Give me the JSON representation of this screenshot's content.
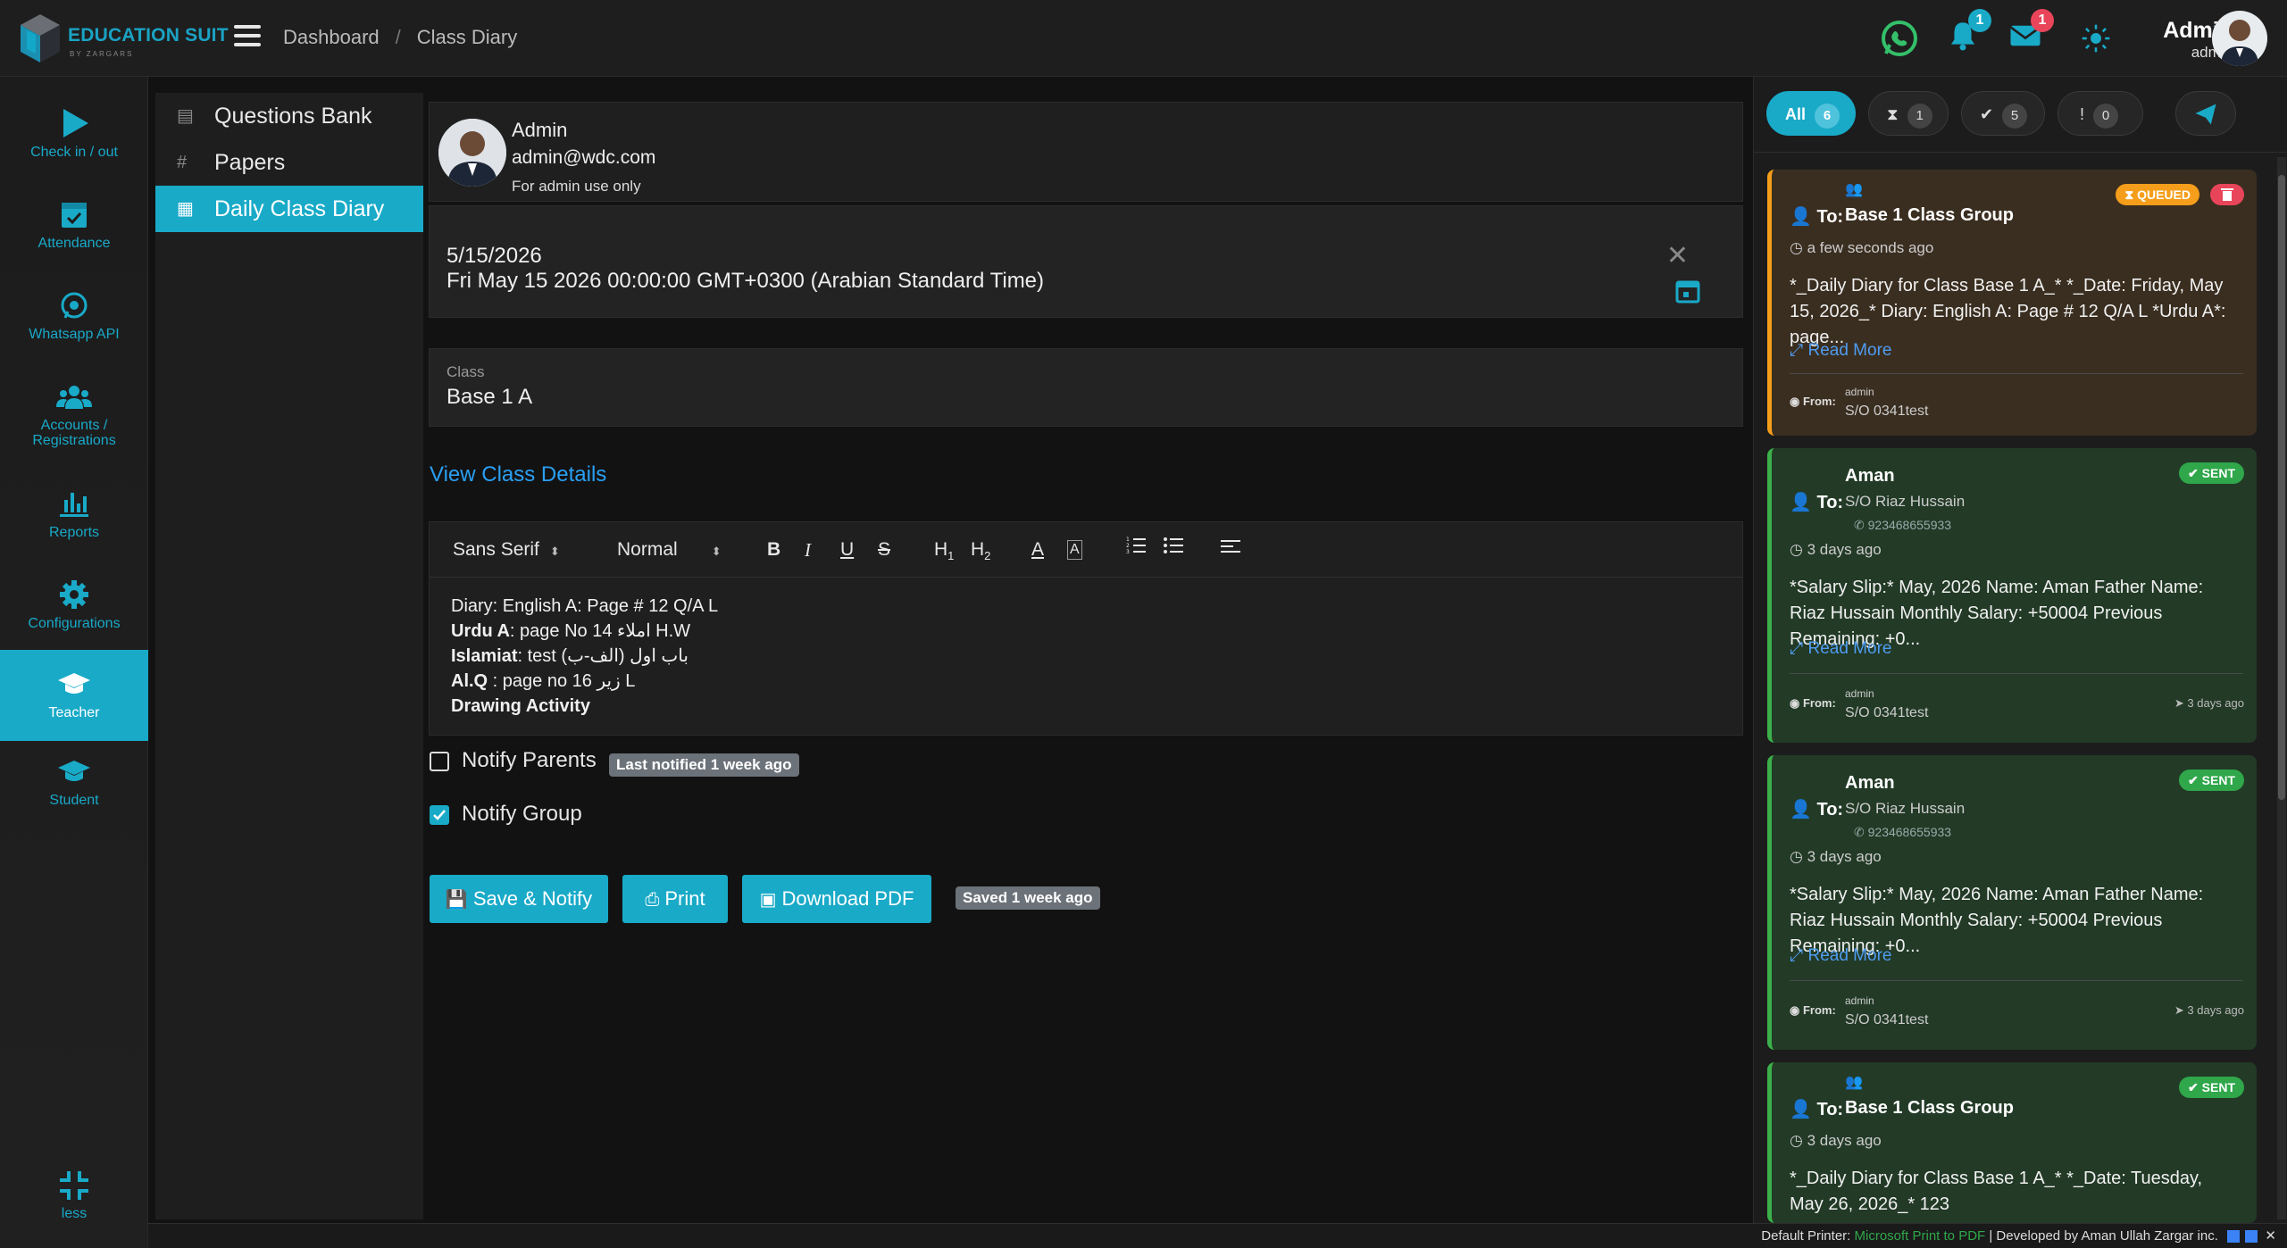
{
  "brand": {
    "title": "EDUCATION SUIT",
    "subtitle": "BY ZARGARS"
  },
  "breadcrumb": {
    "home": "Dashboard",
    "sep": "/",
    "current": "Class Diary"
  },
  "topbar": {
    "notif_count": "1",
    "mail_count": "1",
    "user_name": "Admin",
    "user_role": "admin"
  },
  "leftnav": {
    "checkin": "Check in / out",
    "attendance": "Attendance",
    "whatsapp": "Whatsapp API",
    "accounts_line1": "Accounts /",
    "accounts_line2": "Registrations",
    "reports": "Reports",
    "configurations": "Configurations",
    "teacher": "Teacher",
    "student": "Student",
    "less": "less"
  },
  "submenu": {
    "items": [
      "Questions Bank",
      "Papers",
      "Daily Class Diary"
    ]
  },
  "profile": {
    "name": "Admin",
    "email": "admin@wdc.com",
    "note": "For admin use only"
  },
  "date": {
    "short": "5/15/2026",
    "long": "Fri May 15 2026 00:00:00 GMT+0300 (Arabian Standard Time)",
    "close": "✕"
  },
  "class_field": {
    "label": "Class",
    "value": "Base 1 A"
  },
  "view_class_link": "View Class Details",
  "editor": {
    "font": "Sans Serif",
    "size": "Normal",
    "lines": [
      {
        "bold": "",
        "text": "Diary: English A: Page # 12 Q/A L"
      },
      {
        "bold": "Urdu A",
        "text": ": page No 14 املاء H.W"
      },
      {
        "bold": "Islamiat",
        "text": ": test (الف-ب) باب اول"
      },
      {
        "bold": "Al.Q",
        "text": " : page no 16 زیر L"
      },
      {
        "bold": "Drawing Activity",
        "text": ""
      }
    ]
  },
  "notify_parents": {
    "label": "Notify Parents",
    "chip": "Last notified 1 week ago",
    "checked": false
  },
  "notify_group": {
    "label": "Notify Group",
    "checked": true
  },
  "buttons": {
    "save": "Save & Notify",
    "print": "Print",
    "pdf": "Download PDF",
    "saved_chip": "Saved 1 week ago"
  },
  "filters": [
    {
      "label": "All",
      "count": "6"
    },
    {
      "label": "⧗",
      "count": "1"
    },
    {
      "label": "✔",
      "count": "5"
    },
    {
      "label": "!",
      "count": "0"
    }
  ],
  "messages": [
    {
      "status": "QUEUED",
      "to_label": "To:",
      "recipient": "Base 1 Class Group",
      "sub": "",
      "phone": "",
      "time": "a few seconds ago",
      "body": "*_Daily Diary for Class Base 1 A_* *_Date: Friday, May 15, 2026_* Diary: English A: Page # 12 Q/A L *Urdu A*: page...",
      "read_more": "Read More",
      "from_label": "From:",
      "from_top": "admin",
      "from_bot": "S/O 0341test",
      "sent_time": ""
    },
    {
      "status": "SENT",
      "to_label": "To:",
      "recipient": "Aman",
      "sub": "S/O Riaz Hussain",
      "phone": "923468655933",
      "time": "3 days ago",
      "body": "*Salary Slip:* May, 2026 Name: Aman Father Name: Riaz Hussain Monthly Salary: +50004 Previous Remaining: +0...",
      "read_more": "Read More",
      "from_label": "From:",
      "from_top": "admin",
      "from_bot": "S/O 0341test",
      "sent_time": "3 days ago"
    },
    {
      "status": "SENT",
      "to_label": "To:",
      "recipient": "Aman",
      "sub": "S/O Riaz Hussain",
      "phone": "923468655933",
      "time": "3 days ago",
      "body": "*Salary Slip:* May, 2026 Name: Aman Father Name: Riaz Hussain Monthly Salary: +50004 Previous Remaining: +0...",
      "read_more": "Read More",
      "from_label": "From:",
      "from_top": "admin",
      "from_bot": "S/O 0341test",
      "sent_time": "3 days ago"
    },
    {
      "status": "SENT",
      "to_label": "To:",
      "recipient": "Base 1 Class Group",
      "sub": "",
      "phone": "",
      "time": "3 days ago",
      "body": "*_Daily Diary for Class Base 1 A_* *_Date: Tuesday, May 26, 2026_* 123",
      "read_more": "",
      "from_label": "",
      "from_top": "",
      "from_bot": "",
      "sent_time": ""
    }
  ],
  "footer": {
    "printer_label": "Default Printer: ",
    "printer": "Microsoft Print to PDF",
    "dev": " | Developed by Aman Ullah Zargar inc."
  },
  "colors": {
    "accent": "#19aac8",
    "queued": "#f59e1b",
    "sent": "#3cb04a",
    "link": "#2a9ff2"
  }
}
